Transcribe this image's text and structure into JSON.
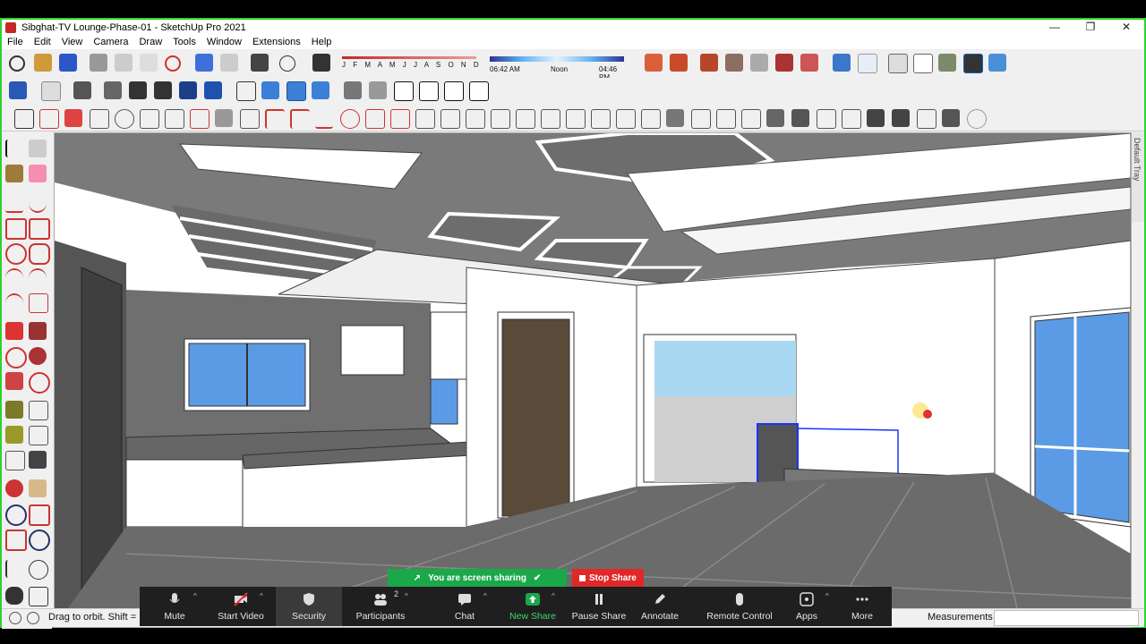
{
  "window": {
    "title": "Sibghat-TV Lounge-Phase-01 - SketchUp Pro 2021",
    "controls": [
      "—",
      "❐",
      "✕"
    ]
  },
  "menu": [
    "File",
    "Edit",
    "View",
    "Camera",
    "Draw",
    "Tools",
    "Window",
    "Extensions",
    "Help"
  ],
  "shadows": {
    "months": "J F M A M J J A S O N D",
    "time_start": "06:42 AM",
    "time_mid": "Noon",
    "time_end": "04:46 PM"
  },
  "tray": {
    "label": "Default Tray"
  },
  "status": {
    "hint": "Drag to orbit. Shift = P",
    "measurements_label": "Measurements",
    "measurements_value": ""
  },
  "screen_share": {
    "message": "You are screen sharing",
    "stop_label": "Stop Share"
  },
  "zoom_toolbar": {
    "participants_count": "2",
    "items": [
      {
        "label": "Mute",
        "icon": "microphone-icon"
      },
      {
        "label": "Start Video",
        "icon": "video-off-icon"
      },
      {
        "label": "Security",
        "icon": "shield-icon"
      },
      {
        "label": "Participants",
        "icon": "people-icon"
      },
      {
        "label": "Chat",
        "icon": "chat-icon"
      },
      {
        "label": "New Share",
        "icon": "share-up-arrow-icon"
      },
      {
        "label": "Pause Share",
        "icon": "pause-icon"
      },
      {
        "label": "Annotate",
        "icon": "pencil-icon"
      },
      {
        "label": "Remote Control",
        "icon": "mouse-icon"
      },
      {
        "label": "Apps",
        "icon": "apps-icon"
      },
      {
        "label": "More",
        "icon": "more-dots-icon"
      }
    ]
  },
  "colors": {
    "share_green": "#1aa84a",
    "stop_red": "#e02828",
    "zoom_bar": "#1f1f1f",
    "selection_blue": "#1a34ff",
    "window_sky": "#5b9be6"
  }
}
